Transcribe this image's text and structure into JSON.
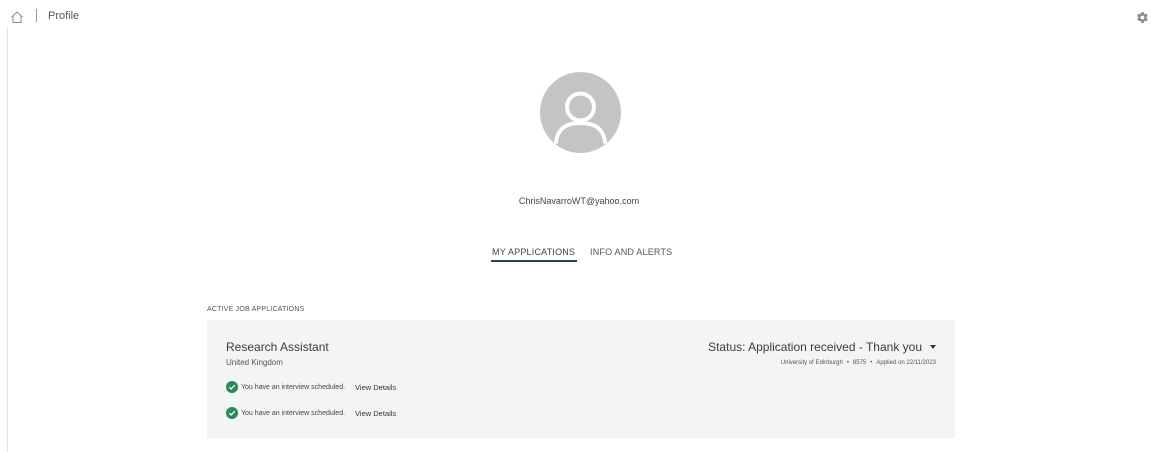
{
  "header": {
    "home_icon": "home-icon",
    "title": "Profile",
    "settings_icon": "gear-icon"
  },
  "profile": {
    "avatar_icon": "user-avatar-icon",
    "email": "ChrisNavarroWT@yahoo.com"
  },
  "tabs": [
    {
      "label": "MY APPLICATIONS",
      "active": true
    },
    {
      "label": "INFO AND ALERTS",
      "active": false
    }
  ],
  "applications": {
    "section_title": "ACTIVE JOB APPLICATIONS",
    "items": [
      {
        "title": "Research Assistant",
        "location": "United Kingdom",
        "status": "Status: Application received - Thank you",
        "employer": "University of Edinburgh",
        "job_id": "8575",
        "applied": "Applied on 22/11/2023",
        "notices": [
          {
            "text": "You have an interview scheduled.",
            "link": "View Details"
          },
          {
            "text": "You have an interview scheduled.",
            "link": "View Details"
          }
        ]
      }
    ]
  },
  "colors": {
    "accent_underline": "#24445c",
    "success_green": "#2b8a5c",
    "card_background": "#f3f4f4",
    "avatar_gray": "#c4c4c4"
  }
}
